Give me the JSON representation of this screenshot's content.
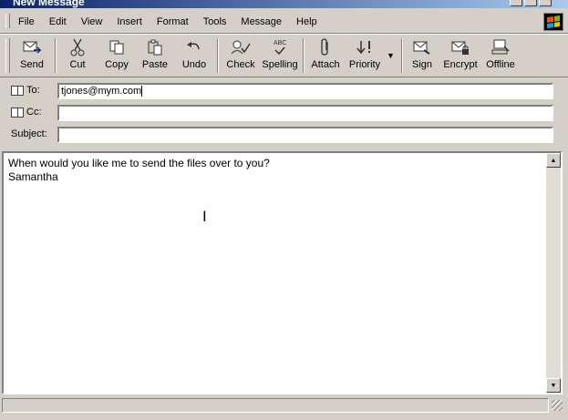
{
  "window": {
    "title": "New Message"
  },
  "menu": [
    "File",
    "Edit",
    "View",
    "Insert",
    "Format",
    "Tools",
    "Message",
    "Help"
  ],
  "toolbar": {
    "send": "Send",
    "cut": "Cut",
    "copy": "Copy",
    "paste": "Paste",
    "undo": "Undo",
    "check": "Check",
    "spelling": "Spelling",
    "spelling_badge": "ABC",
    "attach": "Attach",
    "priority": "Priority",
    "sign": "Sign",
    "encrypt": "Encrypt",
    "offline": "Offline"
  },
  "header": {
    "to_label": "To:",
    "to_value": "tjones@mym.com",
    "cc_label": "Cc:",
    "cc_value": "",
    "subject_label": "Subject:",
    "subject_value": ""
  },
  "body": {
    "lines": [
      "When would you like me to send the files over to you?",
      "",
      "Samantha"
    ]
  }
}
